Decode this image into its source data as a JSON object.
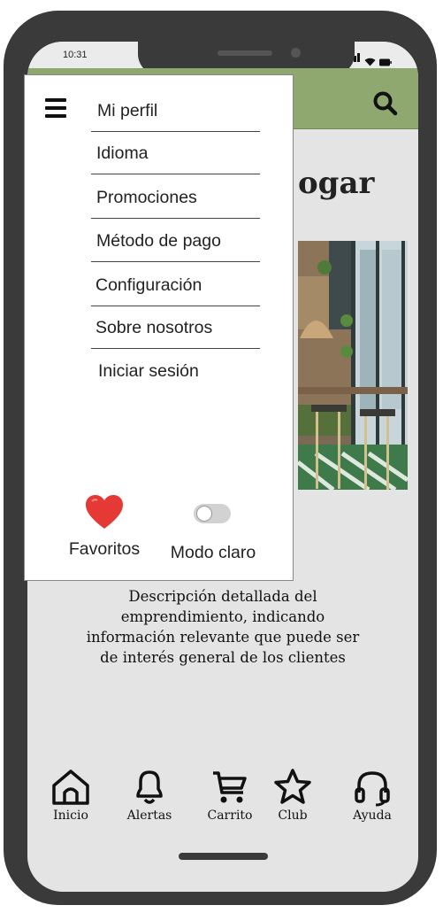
{
  "status": {
    "time": "10:31"
  },
  "page": {
    "heading_fragment": "ogar",
    "description": "Descripción detallada del emprendimiento, indicando información relevante que puede ser de interés general de los clientes"
  },
  "drawer": {
    "menu_items": [
      {
        "label": "Mi perfil"
      },
      {
        "label": "Idioma"
      },
      {
        "label": "Promociones"
      },
      {
        "label": "Método de pago"
      },
      {
        "label": "Configuración"
      },
      {
        "label": "Sobre nosotros"
      },
      {
        "label": "Iniciar sesión"
      }
    ],
    "favorites_label": "Favoritos",
    "light_mode_label": "Modo claro",
    "light_mode_on": false
  },
  "bottom_nav": [
    {
      "label": "Inicio",
      "icon": "home-icon"
    },
    {
      "label": "Alertas",
      "icon": "bell-icon"
    },
    {
      "label": "Carrito",
      "icon": "cart-icon"
    },
    {
      "label": "Club",
      "icon": "star-icon"
    },
    {
      "label": "Ayuda",
      "icon": "headset-icon"
    }
  ],
  "colors": {
    "appbar": "#8fa870",
    "phone_frame": "#3a3a3a",
    "screen_bg": "#e4e4e4",
    "heart": "#e53935"
  }
}
